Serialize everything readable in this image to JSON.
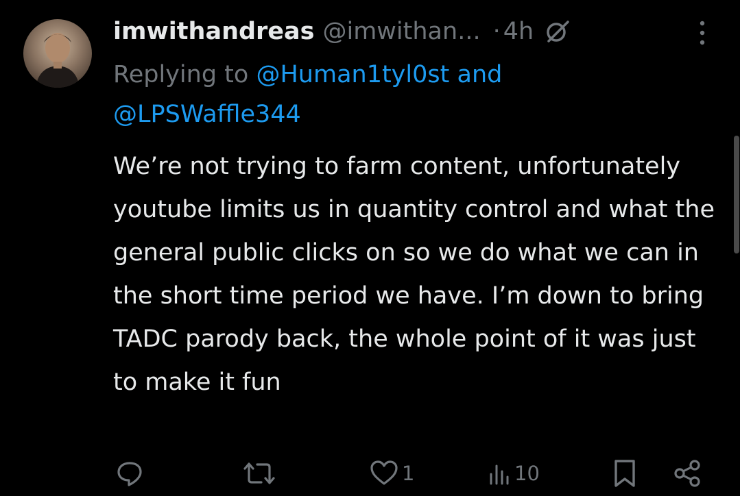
{
  "tweet": {
    "display_name": "imwithandreas",
    "handle": "@imwithan...",
    "separator": "·",
    "time": "4h",
    "replying_prefix": "Replying to",
    "mention_1": "@Human1tyl0st",
    "mention_joiner": "and",
    "mention_2": "@LPSWaffle344",
    "text": "We’re not trying to farm content, unfortunately youtube limits us in quantity control and what the general public clicks on so we do what we can in the short time period we have. I’m down to bring TADC parody back, the whole point of it was just to make it fun"
  },
  "actions": {
    "reply_count": "",
    "retweet_count": "",
    "like_count": "1",
    "views_count": "10"
  },
  "icons": {
    "avatar": "profile-photo",
    "grok": "grok-icon",
    "more": "more-vertical-icon",
    "reply": "reply-icon",
    "retweet": "retweet-icon",
    "like": "heart-icon",
    "views": "views-icon",
    "bookmark": "bookmark-icon",
    "share": "share-icon"
  },
  "colors": {
    "background": "#000000",
    "text": "#e7e9ea",
    "secondary": "#71767b",
    "link": "#1d9bf0"
  }
}
